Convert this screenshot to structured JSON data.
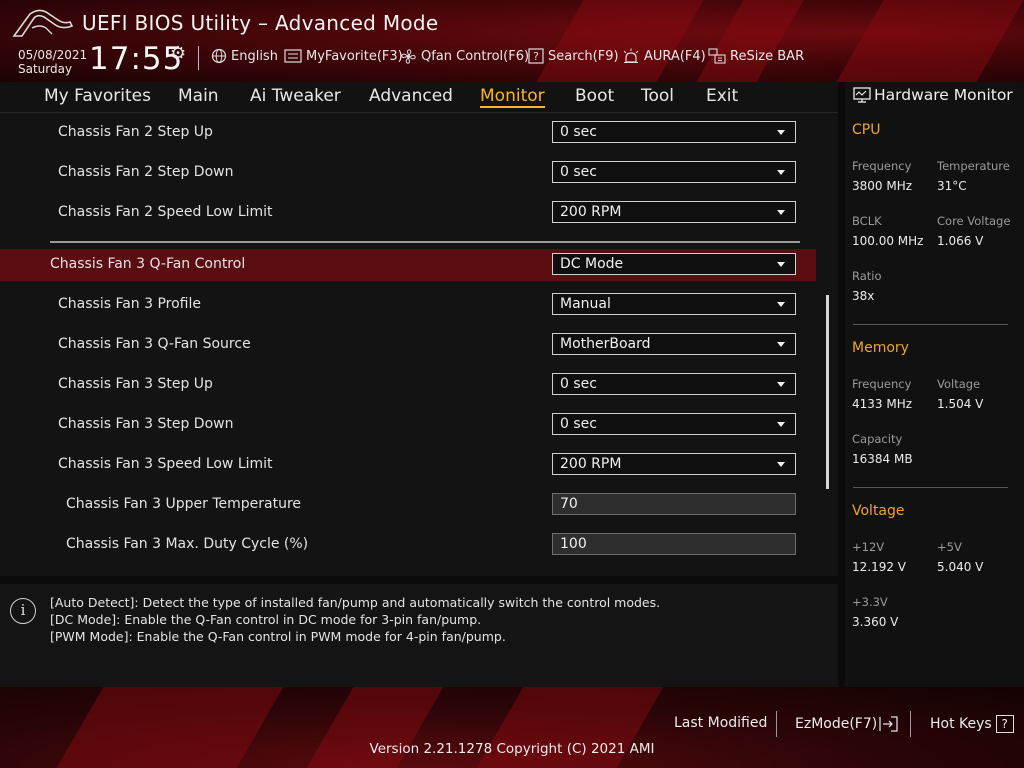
{
  "header": {
    "title": "UEFI BIOS Utility – Advanced Mode",
    "date": "05/08/2021",
    "day": "Saturday",
    "time": "17:55",
    "toolbar": {
      "language": "English",
      "myfavorite": "MyFavorite(F3)",
      "qfan": "Qfan Control(F6)",
      "search": "Search(F9)",
      "aura": "AURA(F4)",
      "resizebar": "ReSize BAR"
    }
  },
  "menu": {
    "items": [
      "My Favorites",
      "Main",
      "Ai Tweaker",
      "Advanced",
      "Monitor",
      "Boot",
      "Tool",
      "Exit"
    ],
    "active": "Monitor"
  },
  "settings": [
    {
      "label": "Chassis Fan 2 Step Up",
      "type": "dropdown",
      "value": "0 sec"
    },
    {
      "label": "Chassis Fan 2 Step Down",
      "type": "dropdown",
      "value": "0 sec"
    },
    {
      "label": "Chassis Fan 2 Speed Low Limit",
      "type": "dropdown",
      "value": "200 RPM"
    },
    {
      "label": "Chassis Fan 3 Q-Fan Control",
      "type": "dropdown",
      "value": "DC Mode",
      "selected": true
    },
    {
      "label": "Chassis Fan 3 Profile",
      "type": "dropdown",
      "value": "Manual"
    },
    {
      "label": "Chassis Fan 3 Q-Fan Source",
      "type": "dropdown",
      "value": "MotherBoard"
    },
    {
      "label": "Chassis Fan 3 Step Up",
      "type": "dropdown",
      "value": "0 sec"
    },
    {
      "label": "Chassis Fan 3 Step Down",
      "type": "dropdown",
      "value": "0 sec"
    },
    {
      "label": "Chassis Fan 3 Speed Low Limit",
      "type": "dropdown",
      "value": "200 RPM"
    },
    {
      "label": "Chassis Fan 3 Upper Temperature",
      "type": "number",
      "value": "70"
    },
    {
      "label": "Chassis Fan 3 Max. Duty Cycle (%)",
      "type": "number",
      "value": "100"
    }
  ],
  "help": {
    "lines": [
      "[Auto Detect]: Detect the type of installed fan/pump and automatically switch the control modes.",
      "[DC Mode]: Enable the Q-Fan control in DC mode for 3-pin fan/pump.",
      "[PWM Mode]: Enable the Q-Fan control in PWM mode for 4-pin fan/pump."
    ]
  },
  "hardware_monitor": {
    "title": "Hardware Monitor",
    "cpu": {
      "heading": "CPU",
      "frequency_label": "Frequency",
      "frequency": "3800 MHz",
      "temperature_label": "Temperature",
      "temperature": "31°C",
      "bclk_label": "BCLK",
      "bclk": "100.00 MHz",
      "core_voltage_label": "Core Voltage",
      "core_voltage": "1.066 V",
      "ratio_label": "Ratio",
      "ratio": "38x"
    },
    "memory": {
      "heading": "Memory",
      "frequency_label": "Frequency",
      "frequency": "4133 MHz",
      "voltage_label": "Voltage",
      "voltage": "1.504 V",
      "capacity_label": "Capacity",
      "capacity": "16384 MB"
    },
    "voltage": {
      "heading": "Voltage",
      "v12_label": "+12V",
      "v12": "12.192 V",
      "v5_label": "+5V",
      "v5": "5.040 V",
      "v33_label": "+3.3V",
      "v33": "3.360 V"
    }
  },
  "footer": {
    "last_modified": "Last Modified",
    "ezmode": "EzMode(F7)",
    "hotkeys": "Hot Keys",
    "hotkeys_icon_char": "?",
    "version": "Version 2.21.1278 Copyright (C) 2021 AMI"
  },
  "colors": {
    "accent": "#ffb12a",
    "selected_row": "#5a0e12",
    "header_red": "#7a0b10"
  }
}
